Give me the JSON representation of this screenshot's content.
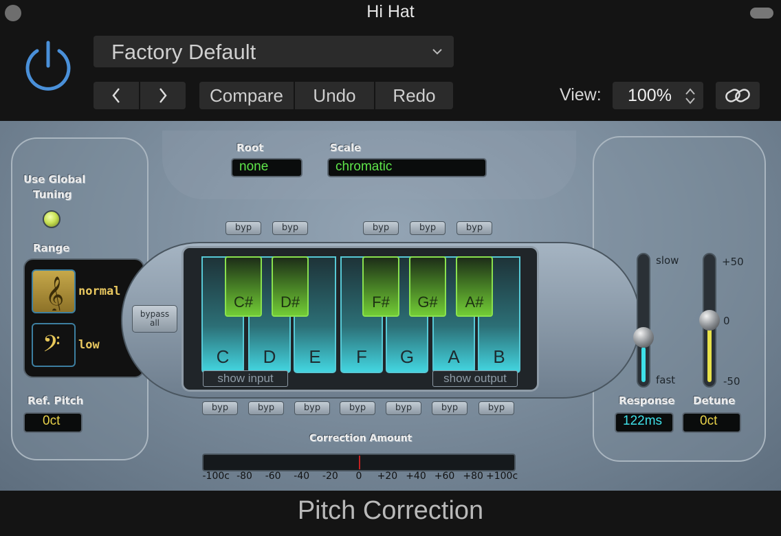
{
  "window": {
    "title": "Hi Hat"
  },
  "header": {
    "preset": "Factory Default",
    "prev_label": "‹",
    "next_label": "›",
    "compare_label": "Compare",
    "undo_label": "Undo",
    "redo_label": "Redo",
    "view_label": "View:",
    "zoom": "100%"
  },
  "plugin": {
    "name": "Pitch Correction",
    "root": {
      "label": "Root",
      "value": "none"
    },
    "scale": {
      "label": "Scale",
      "value": "chromatic"
    },
    "global_tuning": {
      "label_line1": "Use Global",
      "label_line2": "Tuning",
      "on": true
    },
    "range": {
      "label": "Range",
      "normal_label": "normal",
      "low_label": "low",
      "selected": "normal"
    },
    "ref_pitch": {
      "label": "Ref. Pitch",
      "value": "0ct"
    },
    "bypass_all": {
      "line1": "bypass",
      "line2": "all"
    },
    "byp_label": "byp",
    "white_keys": [
      "C",
      "D",
      "E",
      "F",
      "G",
      "A",
      "B"
    ],
    "black_keys": [
      "C#",
      "D#",
      "F#",
      "G#",
      "A#"
    ],
    "show_input": "show input",
    "show_output": "show output",
    "response": {
      "label": "Response",
      "value": "122ms",
      "slow_label": "slow",
      "fast_label": "fast",
      "level": 0.35
    },
    "detune": {
      "label": "Detune",
      "value": "0ct",
      "top_label": "+50",
      "mid_label": "0",
      "bottom_label": "-50",
      "level": 0.5
    },
    "correction": {
      "label": "Correction Amount",
      "ticks": [
        "-100c",
        "-80",
        "-60",
        "-40",
        "-20",
        "0",
        "+20",
        "+40",
        "+60",
        "+80",
        "+100c"
      ],
      "value": 0
    }
  },
  "colors": {
    "lcd_green": "#5fe64a",
    "lcd_cyan": "#3fe0e8",
    "lcd_yellow": "#e8d24a",
    "accent_blue": "#4a90d9"
  }
}
